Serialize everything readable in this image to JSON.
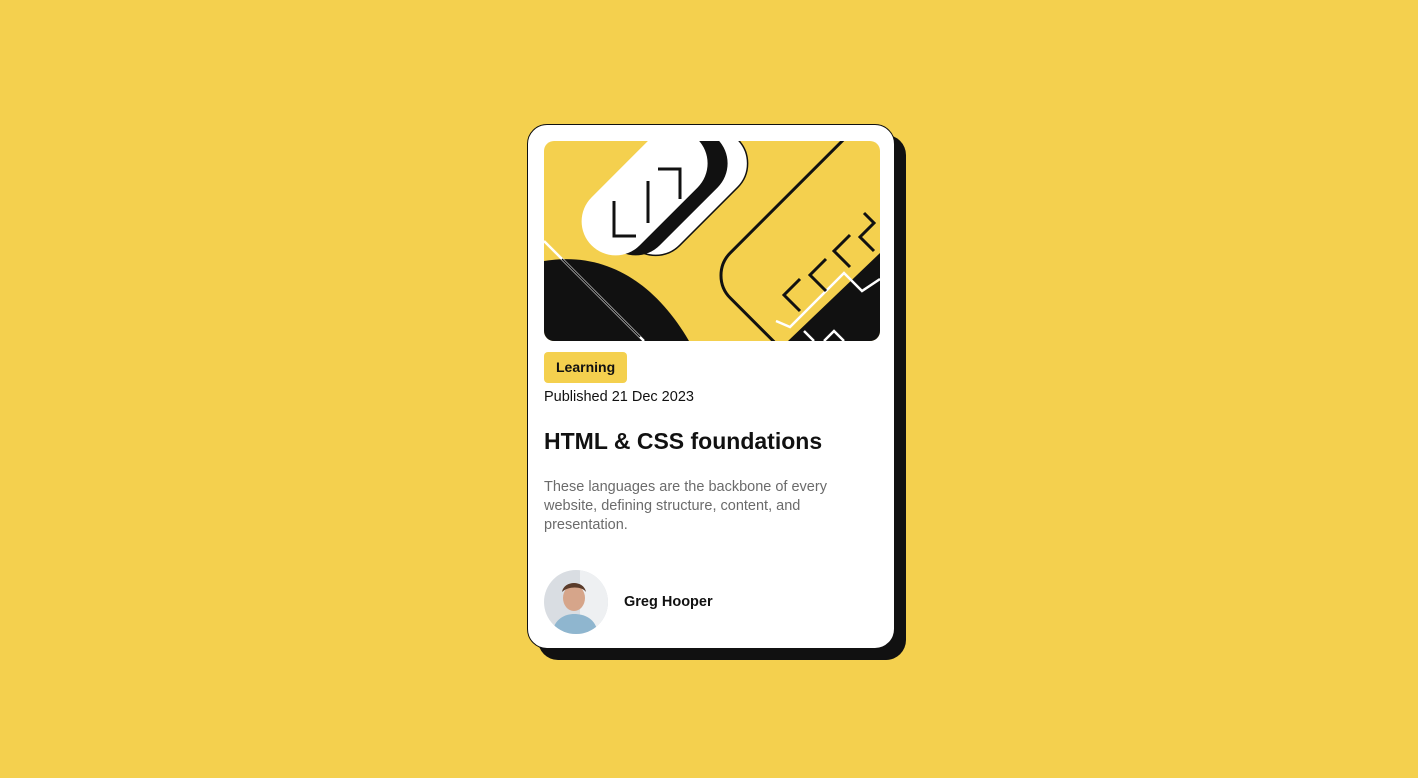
{
  "card": {
    "tag": "Learning",
    "published": "Published 21 Dec 2023",
    "title": "HTML & CSS foundations",
    "description": "These languages are the backbone of every website, defining structure, content, and presentation.",
    "author": "Greg Hooper"
  },
  "colors": {
    "background": "#f4d04e",
    "card": "#ffffff",
    "ink": "#111111",
    "muted_text": "#6b6b6b"
  },
  "icons": {
    "hero": "abstract-code-illustration",
    "avatar": "author-photo"
  }
}
